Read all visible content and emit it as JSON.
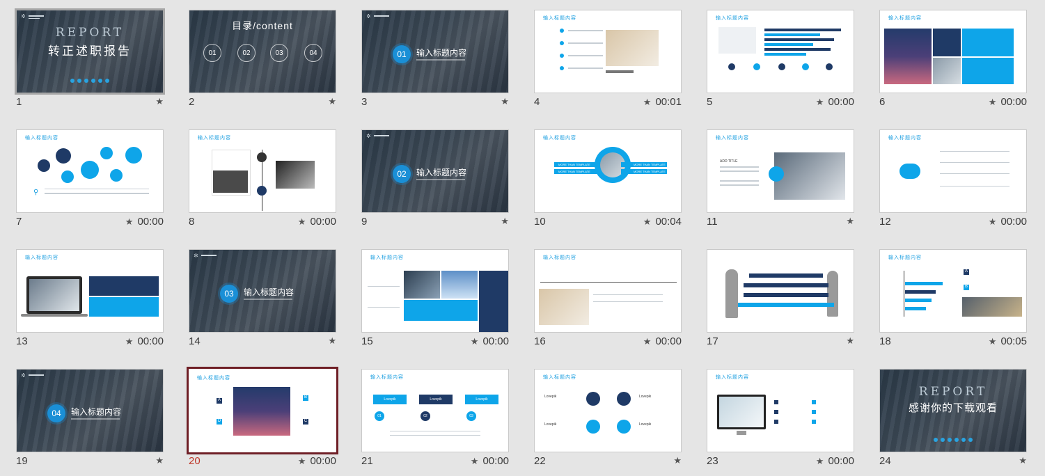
{
  "slides": [
    {
      "n": "1",
      "time": ""
    },
    {
      "n": "2",
      "time": ""
    },
    {
      "n": "3",
      "time": ""
    },
    {
      "n": "4",
      "time": "00:01"
    },
    {
      "n": "5",
      "time": "00:00"
    },
    {
      "n": "6",
      "time": "00:00"
    },
    {
      "n": "7",
      "time": "00:00"
    },
    {
      "n": "8",
      "time": "00:00"
    },
    {
      "n": "9",
      "time": ""
    },
    {
      "n": "10",
      "time": "00:04"
    },
    {
      "n": "11",
      "time": ""
    },
    {
      "n": "12",
      "time": "00:00"
    },
    {
      "n": "13",
      "time": "00:00"
    },
    {
      "n": "14",
      "time": ""
    },
    {
      "n": "15",
      "time": "00:00"
    },
    {
      "n": "16",
      "time": "00:00"
    },
    {
      "n": "17",
      "time": ""
    },
    {
      "n": "18",
      "time": "00:05"
    },
    {
      "n": "19",
      "time": ""
    },
    {
      "n": "20",
      "time": "00:00"
    },
    {
      "n": "21",
      "time": "00:00"
    },
    {
      "n": "22",
      "time": ""
    },
    {
      "n": "23",
      "time": "00:00"
    },
    {
      "n": "24",
      "time": ""
    }
  ],
  "star_glyph": "★",
  "text": {
    "report": "REPORT",
    "cover_title": "转正述职报告",
    "toc_title": "目录/content",
    "toc_nums": [
      "01",
      "02",
      "03",
      "04"
    ],
    "section_title": "输入标题内容",
    "sec_nums": [
      "01",
      "02",
      "03",
      "04"
    ],
    "slide_heading": "输入标题内容",
    "add_title": "ADD TITLE",
    "more_template": "MORE THAN TEMPLATE",
    "lovepik": "Lovepik",
    "end_title": "感谢你的下载观看",
    "step_nums": [
      "01",
      "02",
      "03"
    ],
    "letters": [
      "A",
      "B",
      "C",
      "D"
    ]
  },
  "colors": {
    "accent": "#0ea5e9",
    "navy": "#1f3a66",
    "selected_border": "#6f1f26",
    "selected_number": "#c0392b"
  }
}
